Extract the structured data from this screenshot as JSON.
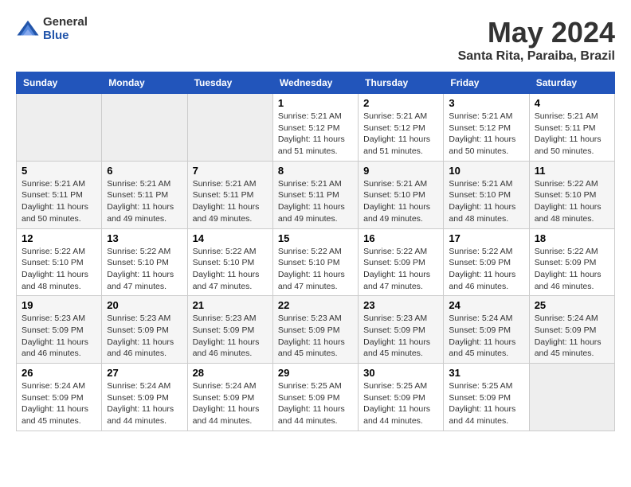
{
  "header": {
    "logo_general": "General",
    "logo_blue": "Blue",
    "month": "May 2024",
    "location": "Santa Rita, Paraiba, Brazil"
  },
  "days_of_week": [
    "Sunday",
    "Monday",
    "Tuesday",
    "Wednesday",
    "Thursday",
    "Friday",
    "Saturday"
  ],
  "weeks": [
    {
      "row_index": 0,
      "days": [
        {
          "num": "",
          "sunrise": "",
          "sunset": "",
          "daylight": "",
          "empty": true
        },
        {
          "num": "",
          "sunrise": "",
          "sunset": "",
          "daylight": "",
          "empty": true
        },
        {
          "num": "",
          "sunrise": "",
          "sunset": "",
          "daylight": "",
          "empty": true
        },
        {
          "num": "1",
          "sunrise": "Sunrise: 5:21 AM",
          "sunset": "Sunset: 5:12 PM",
          "daylight": "Daylight: 11 hours and 51 minutes.",
          "empty": false
        },
        {
          "num": "2",
          "sunrise": "Sunrise: 5:21 AM",
          "sunset": "Sunset: 5:12 PM",
          "daylight": "Daylight: 11 hours and 51 minutes.",
          "empty": false
        },
        {
          "num": "3",
          "sunrise": "Sunrise: 5:21 AM",
          "sunset": "Sunset: 5:12 PM",
          "daylight": "Daylight: 11 hours and 50 minutes.",
          "empty": false
        },
        {
          "num": "4",
          "sunrise": "Sunrise: 5:21 AM",
          "sunset": "Sunset: 5:11 PM",
          "daylight": "Daylight: 11 hours and 50 minutes.",
          "empty": false
        }
      ]
    },
    {
      "row_index": 1,
      "days": [
        {
          "num": "5",
          "sunrise": "Sunrise: 5:21 AM",
          "sunset": "Sunset: 5:11 PM",
          "daylight": "Daylight: 11 hours and 50 minutes.",
          "empty": false
        },
        {
          "num": "6",
          "sunrise": "Sunrise: 5:21 AM",
          "sunset": "Sunset: 5:11 PM",
          "daylight": "Daylight: 11 hours and 49 minutes.",
          "empty": false
        },
        {
          "num": "7",
          "sunrise": "Sunrise: 5:21 AM",
          "sunset": "Sunset: 5:11 PM",
          "daylight": "Daylight: 11 hours and 49 minutes.",
          "empty": false
        },
        {
          "num": "8",
          "sunrise": "Sunrise: 5:21 AM",
          "sunset": "Sunset: 5:11 PM",
          "daylight": "Daylight: 11 hours and 49 minutes.",
          "empty": false
        },
        {
          "num": "9",
          "sunrise": "Sunrise: 5:21 AM",
          "sunset": "Sunset: 5:10 PM",
          "daylight": "Daylight: 11 hours and 49 minutes.",
          "empty": false
        },
        {
          "num": "10",
          "sunrise": "Sunrise: 5:21 AM",
          "sunset": "Sunset: 5:10 PM",
          "daylight": "Daylight: 11 hours and 48 minutes.",
          "empty": false
        },
        {
          "num": "11",
          "sunrise": "Sunrise: 5:22 AM",
          "sunset": "Sunset: 5:10 PM",
          "daylight": "Daylight: 11 hours and 48 minutes.",
          "empty": false
        }
      ]
    },
    {
      "row_index": 2,
      "days": [
        {
          "num": "12",
          "sunrise": "Sunrise: 5:22 AM",
          "sunset": "Sunset: 5:10 PM",
          "daylight": "Daylight: 11 hours and 48 minutes.",
          "empty": false
        },
        {
          "num": "13",
          "sunrise": "Sunrise: 5:22 AM",
          "sunset": "Sunset: 5:10 PM",
          "daylight": "Daylight: 11 hours and 47 minutes.",
          "empty": false
        },
        {
          "num": "14",
          "sunrise": "Sunrise: 5:22 AM",
          "sunset": "Sunset: 5:10 PM",
          "daylight": "Daylight: 11 hours and 47 minutes.",
          "empty": false
        },
        {
          "num": "15",
          "sunrise": "Sunrise: 5:22 AM",
          "sunset": "Sunset: 5:10 PM",
          "daylight": "Daylight: 11 hours and 47 minutes.",
          "empty": false
        },
        {
          "num": "16",
          "sunrise": "Sunrise: 5:22 AM",
          "sunset": "Sunset: 5:09 PM",
          "daylight": "Daylight: 11 hours and 47 minutes.",
          "empty": false
        },
        {
          "num": "17",
          "sunrise": "Sunrise: 5:22 AM",
          "sunset": "Sunset: 5:09 PM",
          "daylight": "Daylight: 11 hours and 46 minutes.",
          "empty": false
        },
        {
          "num": "18",
          "sunrise": "Sunrise: 5:22 AM",
          "sunset": "Sunset: 5:09 PM",
          "daylight": "Daylight: 11 hours and 46 minutes.",
          "empty": false
        }
      ]
    },
    {
      "row_index": 3,
      "days": [
        {
          "num": "19",
          "sunrise": "Sunrise: 5:23 AM",
          "sunset": "Sunset: 5:09 PM",
          "daylight": "Daylight: 11 hours and 46 minutes.",
          "empty": false
        },
        {
          "num": "20",
          "sunrise": "Sunrise: 5:23 AM",
          "sunset": "Sunset: 5:09 PM",
          "daylight": "Daylight: 11 hours and 46 minutes.",
          "empty": false
        },
        {
          "num": "21",
          "sunrise": "Sunrise: 5:23 AM",
          "sunset": "Sunset: 5:09 PM",
          "daylight": "Daylight: 11 hours and 46 minutes.",
          "empty": false
        },
        {
          "num": "22",
          "sunrise": "Sunrise: 5:23 AM",
          "sunset": "Sunset: 5:09 PM",
          "daylight": "Daylight: 11 hours and 45 minutes.",
          "empty": false
        },
        {
          "num": "23",
          "sunrise": "Sunrise: 5:23 AM",
          "sunset": "Sunset: 5:09 PM",
          "daylight": "Daylight: 11 hours and 45 minutes.",
          "empty": false
        },
        {
          "num": "24",
          "sunrise": "Sunrise: 5:24 AM",
          "sunset": "Sunset: 5:09 PM",
          "daylight": "Daylight: 11 hours and 45 minutes.",
          "empty": false
        },
        {
          "num": "25",
          "sunrise": "Sunrise: 5:24 AM",
          "sunset": "Sunset: 5:09 PM",
          "daylight": "Daylight: 11 hours and 45 minutes.",
          "empty": false
        }
      ]
    },
    {
      "row_index": 4,
      "days": [
        {
          "num": "26",
          "sunrise": "Sunrise: 5:24 AM",
          "sunset": "Sunset: 5:09 PM",
          "daylight": "Daylight: 11 hours and 45 minutes.",
          "empty": false
        },
        {
          "num": "27",
          "sunrise": "Sunrise: 5:24 AM",
          "sunset": "Sunset: 5:09 PM",
          "daylight": "Daylight: 11 hours and 44 minutes.",
          "empty": false
        },
        {
          "num": "28",
          "sunrise": "Sunrise: 5:24 AM",
          "sunset": "Sunset: 5:09 PM",
          "daylight": "Daylight: 11 hours and 44 minutes.",
          "empty": false
        },
        {
          "num": "29",
          "sunrise": "Sunrise: 5:25 AM",
          "sunset": "Sunset: 5:09 PM",
          "daylight": "Daylight: 11 hours and 44 minutes.",
          "empty": false
        },
        {
          "num": "30",
          "sunrise": "Sunrise: 5:25 AM",
          "sunset": "Sunset: 5:09 PM",
          "daylight": "Daylight: 11 hours and 44 minutes.",
          "empty": false
        },
        {
          "num": "31",
          "sunrise": "Sunrise: 5:25 AM",
          "sunset": "Sunset: 5:09 PM",
          "daylight": "Daylight: 11 hours and 44 minutes.",
          "empty": false
        },
        {
          "num": "",
          "sunrise": "",
          "sunset": "",
          "daylight": "",
          "empty": true
        }
      ]
    }
  ]
}
